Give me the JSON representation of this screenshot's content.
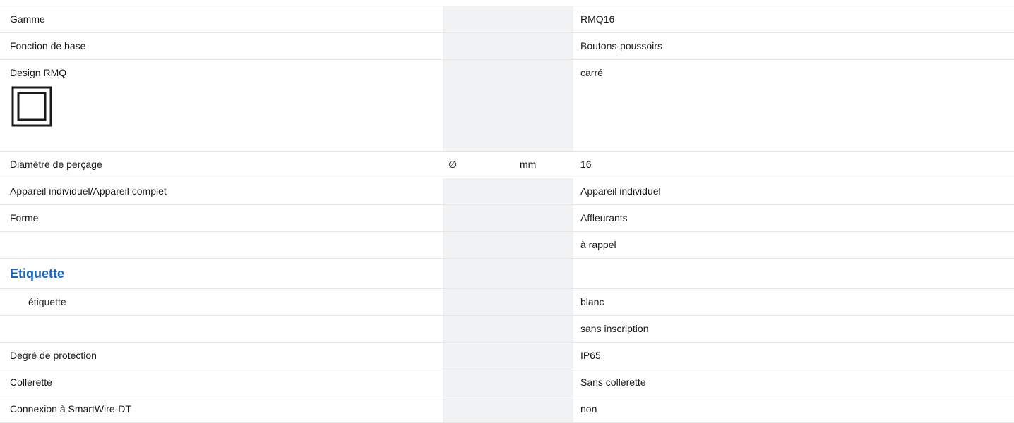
{
  "rows": [
    {
      "label": "Gamme",
      "symbol": "",
      "unit": "",
      "value": "RMQ16"
    },
    {
      "label": "Fonction de base",
      "symbol": "",
      "unit": "",
      "value": "Boutons-poussoirs"
    },
    {
      "label": "Design RMQ",
      "symbol": "",
      "unit": "",
      "value": "carré",
      "icon": "square-design-icon"
    },
    {
      "label": "Diamètre de perçage",
      "symbol": "∅",
      "unit": "mm",
      "value": "16"
    },
    {
      "label": "Appareil individuel/Appareil complet",
      "symbol": "",
      "unit": "",
      "value": "Appareil individuel"
    },
    {
      "label": "Forme",
      "symbol": "",
      "unit": "",
      "value": "Affleurants"
    },
    {
      "label": "",
      "symbol": "",
      "unit": "",
      "value": "à rappel"
    },
    {
      "section": "Etiquette"
    },
    {
      "label": "étiquette",
      "symbol": "",
      "unit": "",
      "value": "blanc"
    },
    {
      "label": "",
      "symbol": "",
      "unit": "",
      "value": "sans inscription"
    },
    {
      "label": "Degré de protection",
      "symbol": "",
      "unit": "",
      "value": "IP65"
    },
    {
      "label": "Collerette",
      "symbol": "",
      "unit": "",
      "value": "Sans collerette"
    },
    {
      "label": "Connexion à SmartWire-DT",
      "symbol": "",
      "unit": "",
      "value": "non"
    }
  ],
  "colors": {
    "section_title": "#1565c0",
    "unit_column_bg": "#f1f2f4",
    "row_divider": "#e6e6e6"
  }
}
